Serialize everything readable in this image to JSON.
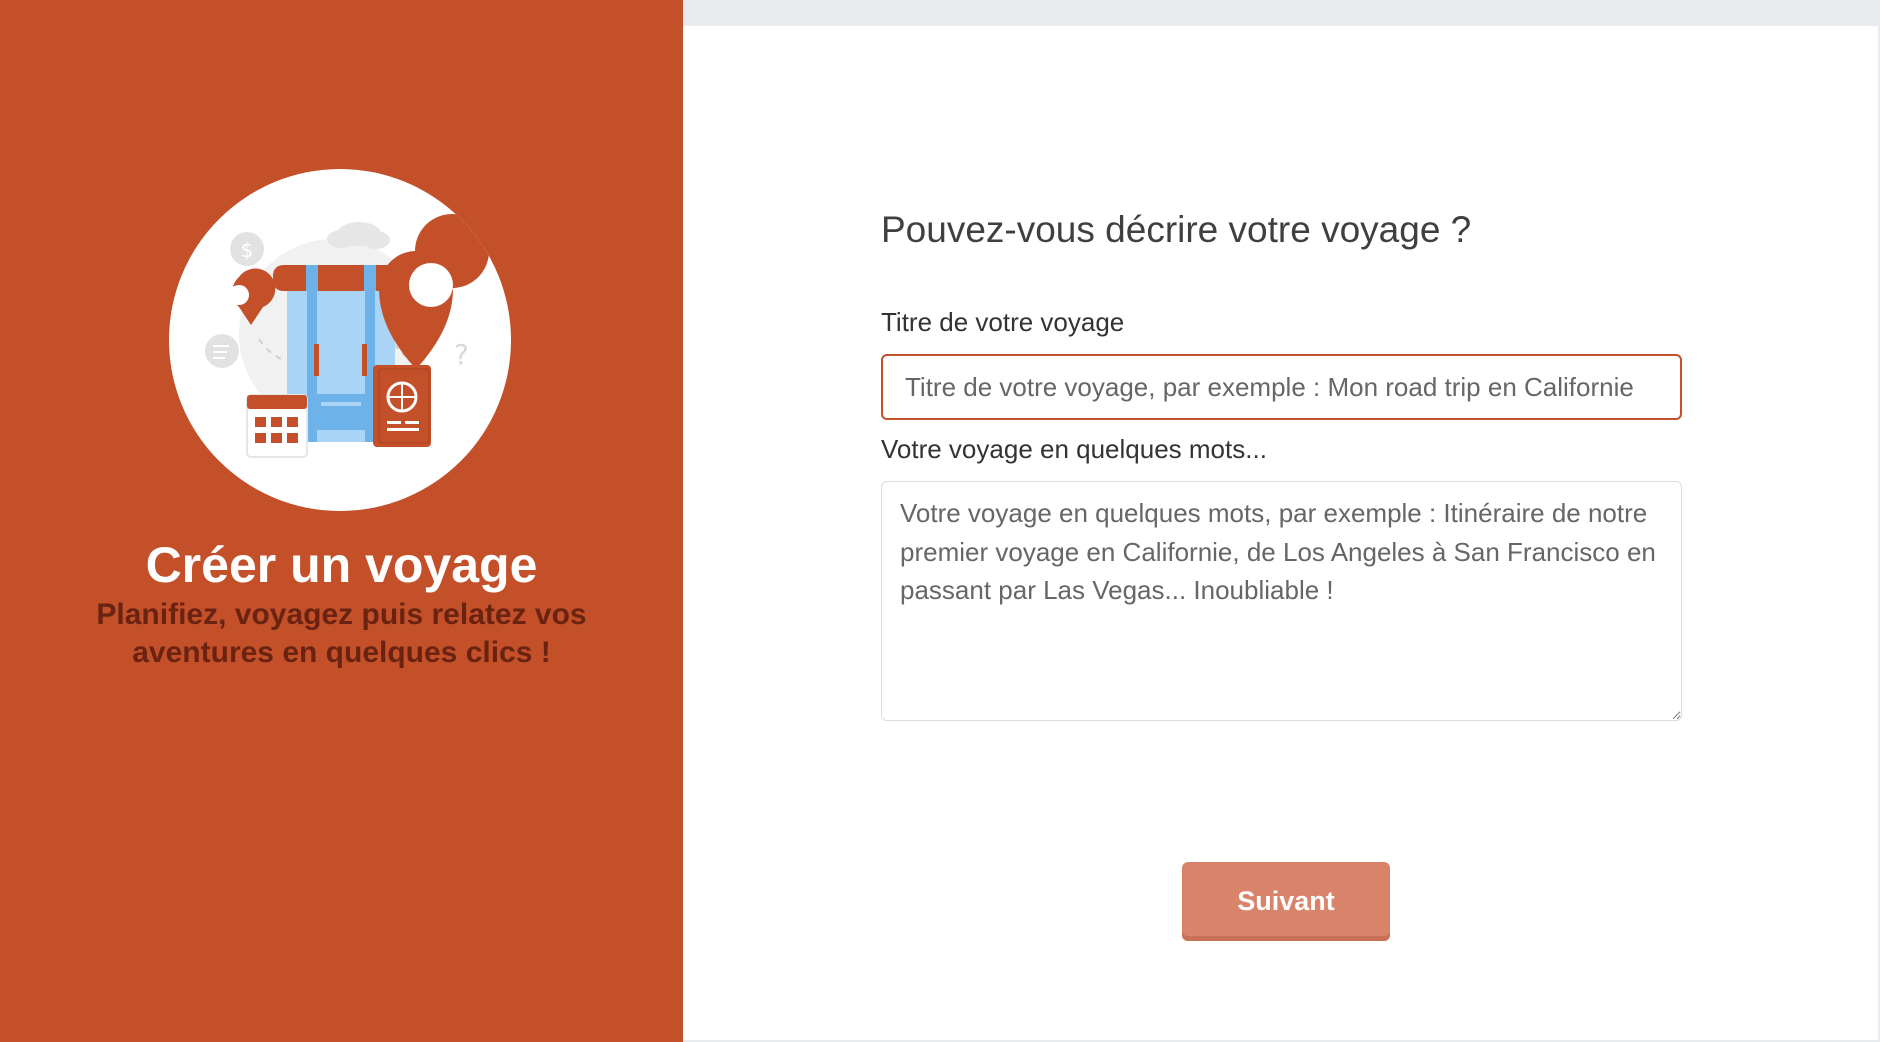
{
  "sidebar": {
    "title": "Créer un voyage",
    "subtitle": "Planifiez, voyagez puis relatez vos aventures en quelques clics !",
    "illustration": "travel-backpack-illustration"
  },
  "form": {
    "question": "Pouvez-vous décrire votre voyage ?",
    "title_label": "Titre de votre voyage",
    "title_value": "",
    "title_placeholder": "Titre de votre voyage, par exemple : Mon road trip en Californie",
    "description_label": "Votre voyage en quelques mots...",
    "description_value": "",
    "description_placeholder": "Votre voyage en quelques mots, par exemple : Itinéraire de notre premier voyage en Californie, de Los Angeles à San Francisco en passant par Las Vegas... Inoubliable !",
    "next_label": "Suivant"
  },
  "colors": {
    "brand": "#c4502a",
    "subtitle": "#6a2310",
    "button": "#d9836a",
    "backpack": "#a9d4f5"
  }
}
